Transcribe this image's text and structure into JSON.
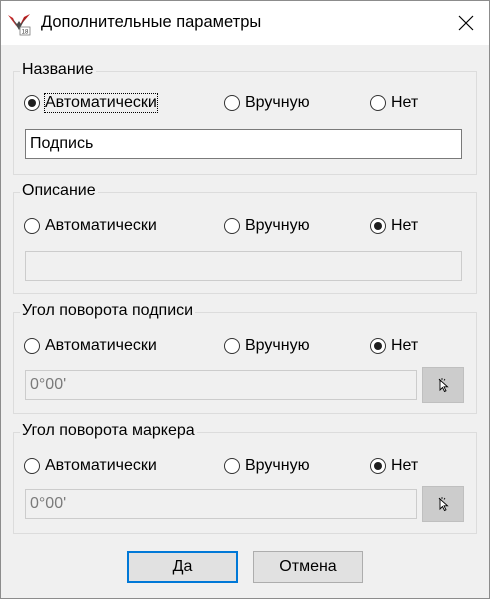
{
  "window": {
    "title": "Дополнительные параметры",
    "app_icon": "app-logo-icon",
    "close_icon": "close-icon"
  },
  "options": {
    "auto": "Автоматически",
    "manual": "Вручную",
    "none": "Нет"
  },
  "groups": {
    "name": {
      "label": "Название",
      "selected": "auto",
      "value": "Подпись"
    },
    "description": {
      "label": "Описание",
      "selected": "none",
      "value": ""
    },
    "label_angle": {
      "label": "Угол поворота подписи",
      "selected": "none",
      "value": "0°00'",
      "pick_icon": "cursor-pick-icon"
    },
    "marker_angle": {
      "label": "Угол поворота маркера",
      "selected": "none",
      "value": "0°00'",
      "pick_icon": "cursor-pick-icon"
    }
  },
  "buttons": {
    "ok": "Да",
    "cancel": "Отмена"
  },
  "colors": {
    "focus_border": "#0078d7",
    "dialog_bg": "#f0f0f0"
  }
}
